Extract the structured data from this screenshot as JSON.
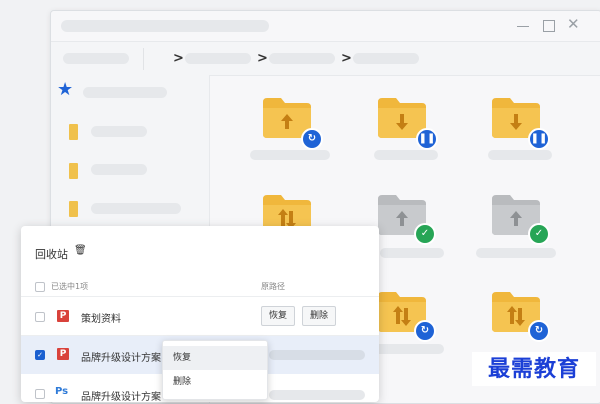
{
  "recycle_bin": {
    "title": "回收站",
    "header_selected": "已选中1项",
    "header_original_path": "原路径",
    "rows": [
      {
        "name": "策划资料",
        "restore": "恢复",
        "delete": "删除"
      },
      {
        "name": "品牌升级设计方案"
      },
      {
        "name": "品牌升级设计方案"
      }
    ]
  },
  "context_menu": {
    "restore": "恢复",
    "delete": "删除"
  },
  "watermark": "最需教育",
  "colors": {
    "folder": "#f0b73c",
    "folder_gray": "#c4c6c9",
    "badge_blue": "#1f63d6",
    "badge_green": "#27a556"
  }
}
